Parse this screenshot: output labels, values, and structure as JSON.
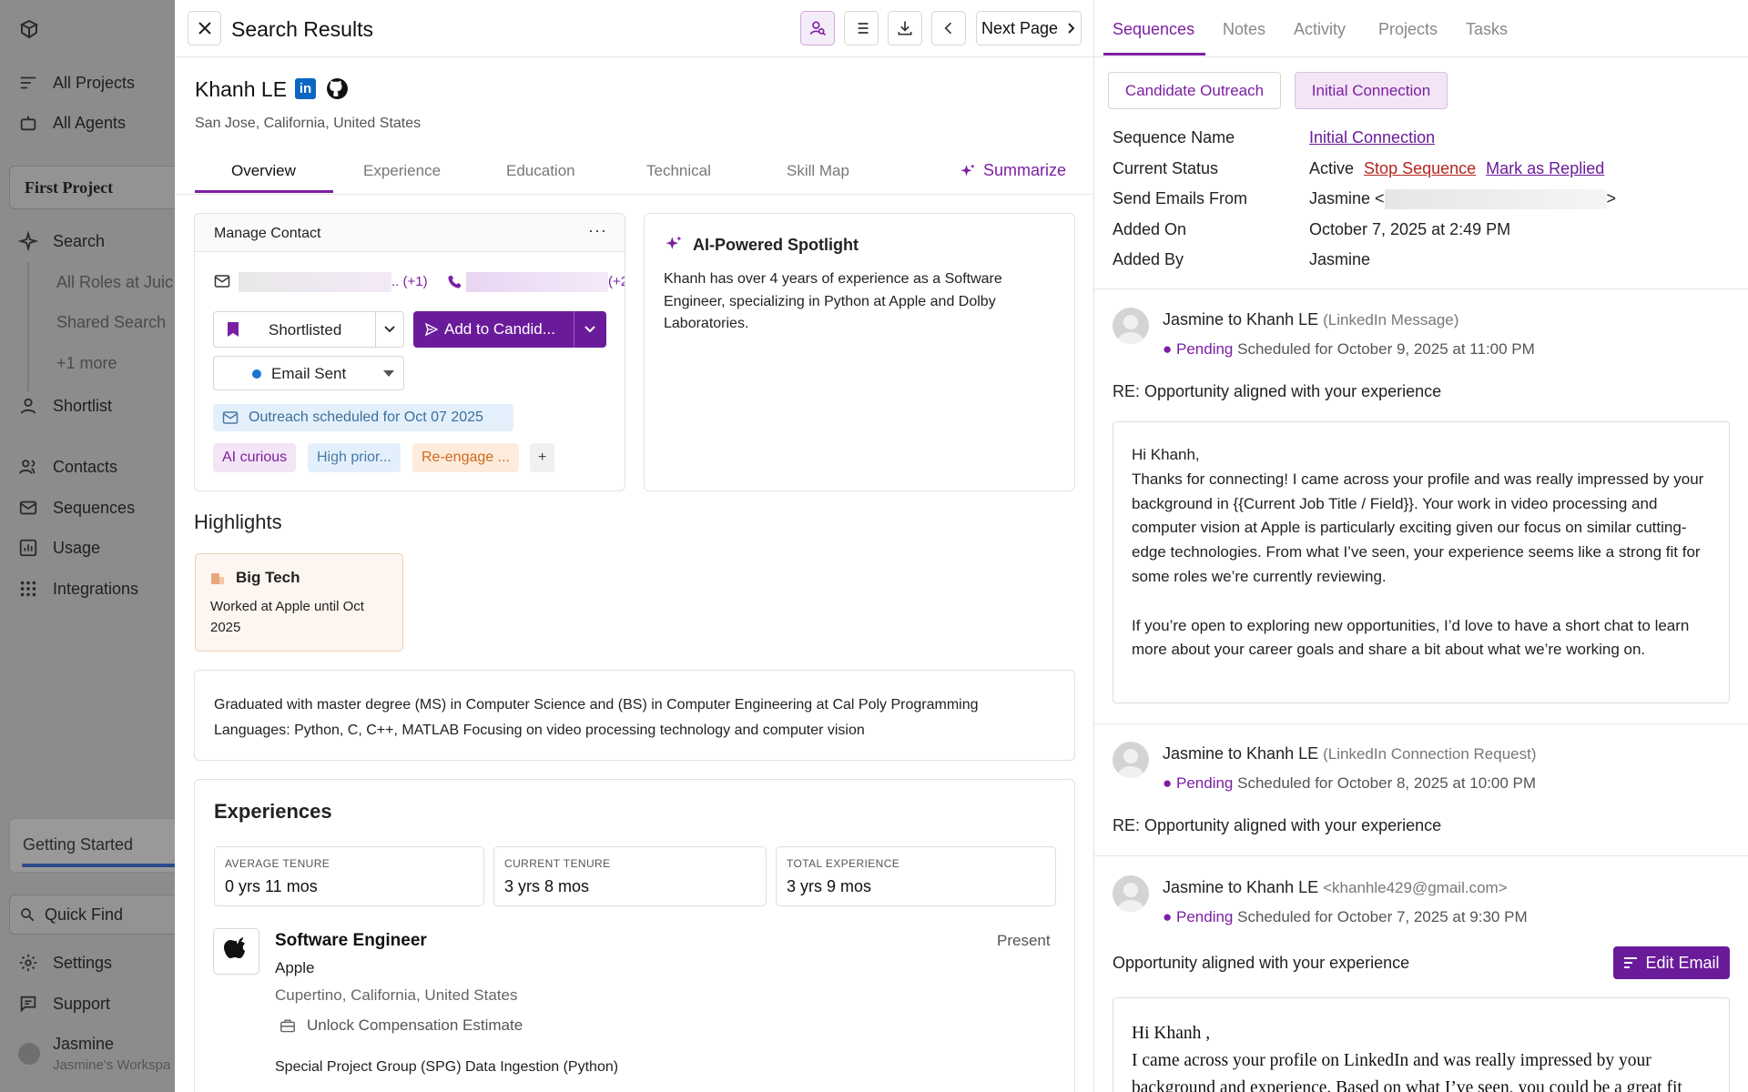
{
  "sidebar": {
    "items": [
      {
        "label": "All Projects",
        "icon": "list-icon"
      },
      {
        "label": "All Agents",
        "icon": "robot-icon"
      }
    ],
    "project_button": "First Project",
    "search": {
      "label": "Search",
      "sub_items": [
        "All Roles at Juic",
        "Shared Search",
        "+1 more"
      ]
    },
    "shortlist": "Shortlist",
    "nav": [
      "Contacts",
      "Sequences",
      "Usage",
      "Integrations"
    ],
    "getting_started": "Getting Started",
    "getting_started_progress": 1.0,
    "quick_find": "Quick Find",
    "settings": "Settings",
    "support": "Support",
    "user": {
      "name": "Jasmine",
      "workspace": "Jasmine's Workspa"
    }
  },
  "header": {
    "title": "Search Results",
    "next_page": "Next Page"
  },
  "profile": {
    "name": "Khanh LE",
    "location": "San Jose, California, United States",
    "tabs": [
      "Overview",
      "Experience",
      "Education",
      "Technical",
      "Skill Map"
    ],
    "active_tab": "Overview",
    "summarize": "Summarize"
  },
  "manage_contact": {
    "title": "Manage Contact",
    "email_extra": ".. (+1)",
    "phone_extra": "(+2",
    "status": "Shortlisted",
    "add_button": "Add to Candid...",
    "email_status": "Email Sent",
    "outreach": "Outreach scheduled for Oct 07 2025",
    "tags": [
      "AI curious",
      "High prior...",
      "Re-engage ..."
    ],
    "add_tag": "+"
  },
  "spotlight": {
    "title": "AI-Powered Spotlight",
    "text": "Khanh has over 4 years of experience as a Software Engineer, specializing in Python at Apple and Dolby Laboratories."
  },
  "highlights": {
    "title": "Highlights",
    "card_title": "Big Tech",
    "card_text": "Worked at Apple until Oct 2025"
  },
  "summary_text": "Graduated with master degree (MS) in Computer Science and (BS) in Computer Engineering at Cal Poly Programming Languages: Python, C, C++, MATLAB Focusing on video processing technology and computer vision",
  "experiences": {
    "title": "Experiences",
    "stats": [
      {
        "label": "AVERAGE TENURE",
        "value": "0 yrs 11 mos"
      },
      {
        "label": "CURRENT TENURE",
        "value": "3 yrs 8 mos"
      },
      {
        "label": "TOTAL EXPERIENCE",
        "value": "3 yrs 9 mos"
      }
    ],
    "job": {
      "title": "Software Engineer",
      "company": "Apple",
      "location": "Cupertino, California, United States",
      "period": "Present",
      "compensation": "Unlock Compensation Estimate",
      "project": "Special Project Group (SPG) Data Ingestion (Python)"
    }
  },
  "right": {
    "tabs": [
      "Sequences",
      "Notes",
      "Activity",
      "Projects",
      "Tasks"
    ],
    "active_tab": "Sequences",
    "sequence_buttons": [
      "Candidate Outreach",
      "Initial Connection"
    ],
    "details": {
      "labels": [
        "Sequence Name",
        "Current Status",
        "Send Emails From",
        "Added On",
        "Added By"
      ],
      "sequence_name": "Initial Connection",
      "status": "Active",
      "stop": "Stop Sequence",
      "mark": "Mark as Replied",
      "from_prefix": "Jasmine <",
      "from_suffix": ">",
      "added_on": "October 7, 2025 at 2:49 PM",
      "added_by": "Jasmine"
    },
    "messages": [
      {
        "from": "Jasmine to Khanh LE",
        "channel": "(LinkedIn Message)",
        "status": "Pending",
        "schedule": "Scheduled for October 9, 2025 at 11:00 PM",
        "subject": "RE: Opportunity aligned with your experience",
        "body": [
          "Hi Khanh,",
          "Thanks for connecting! I came across your profile and was really impressed by your background in {{Current Job Title / Field}}. Your work in video processing and computer vision at Apple is particularly exciting given our focus on similar cutting-edge technologies. From what I’ve seen, your experience seems like a strong fit for some roles we’re currently reviewing.",
          "If you’re open to exploring new opportunities, I’d love to have a short chat to learn more about your career goals and share a bit about what we’re working on."
        ]
      },
      {
        "from": "Jasmine to Khanh LE",
        "channel": "(LinkedIn Connection Request)",
        "status": "Pending",
        "schedule": "Scheduled for October 8, 2025 at 10:00 PM",
        "subject": "RE: Opportunity aligned with your experience"
      },
      {
        "from": "Jasmine to Khanh LE",
        "channel": "<khanhle429@gmail.com>",
        "status": "Pending",
        "schedule": "Scheduled for October 7, 2025 at 9:30 PM",
        "subject": "Opportunity aligned with your experience",
        "edit": "Edit Email",
        "body": [
          "Hi Khanh ,",
          "I came across your profile on LinkedIn and was really impressed by your background and experience. Based on what I’ve seen, you could be a great fit"
        ]
      }
    ]
  },
  "colors": {
    "accent": "#7b1fa2",
    "accent_btn": "#6a1b9a",
    "tag_purple_bg": "#f3e5f5",
    "tag_blue_bg": "#e3f0fb",
    "tag_orange_bg": "#fdebdc"
  }
}
